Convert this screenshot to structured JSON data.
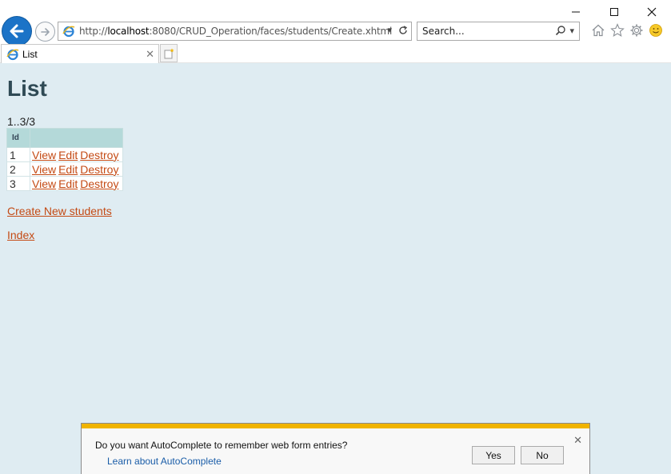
{
  "browser": {
    "address": {
      "prefix": "http://",
      "host": "localhost",
      "rest": ":8080/CRUD_Operation/faces/students/Create.xhtml"
    },
    "search": {
      "placeholder": "Search..."
    },
    "tab": {
      "label": "List"
    }
  },
  "page": {
    "title": "List",
    "range_text": "1..3/3",
    "table": {
      "header": "Id",
      "rows": [
        {
          "id": "1",
          "view": "View",
          "edit": "Edit",
          "destroy": "Destroy"
        },
        {
          "id": "2",
          "view": "View",
          "edit": "Edit",
          "destroy": "Destroy"
        },
        {
          "id": "3",
          "view": "View",
          "edit": "Edit",
          "destroy": "Destroy"
        }
      ]
    },
    "create_link": "Create New students",
    "index_link": "Index"
  },
  "notification": {
    "message": "Do you want AutoComplete to remember web form entries?",
    "learn_link": "Learn about AutoComplete",
    "yes_label": "Yes",
    "no_label": "No",
    "accent_color": "#f0b400"
  },
  "colors": {
    "page_background": "#dfecf2",
    "link": "#c44a14",
    "table_header": "#b4d9d9"
  }
}
